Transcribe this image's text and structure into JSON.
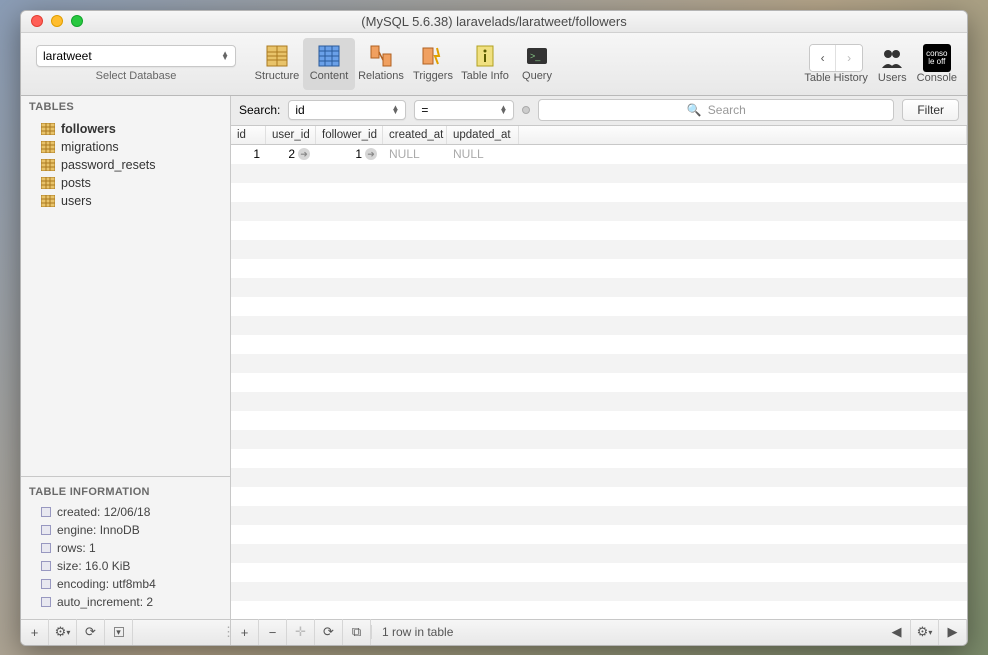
{
  "window": {
    "title": "(MySQL 5.6.38) laravelads/laratweet/followers"
  },
  "dbselect": {
    "value": "laratweet",
    "label": "Select Database"
  },
  "toolbar": {
    "buttons": {
      "structure": "Structure",
      "content": "Content",
      "relations": "Relations",
      "triggers": "Triggers",
      "tableinfo": "Table Info",
      "query": "Query"
    },
    "right": {
      "history": "Table History",
      "users": "Users",
      "console": "Console",
      "console_line1": "conso",
      "console_line2": "le off"
    }
  },
  "sidebar": {
    "tables_header": "TABLES",
    "tables": [
      "followers",
      "migrations",
      "password_resets",
      "posts",
      "users"
    ],
    "selected": "followers",
    "info_header": "TABLE INFORMATION",
    "info": [
      "created: 12/06/18",
      "engine: InnoDB",
      "rows: 1",
      "size: 16.0 KiB",
      "encoding: utf8mb4",
      "auto_increment: 2"
    ]
  },
  "search": {
    "label": "Search:",
    "field": "id",
    "op": "=",
    "placeholder": "Search",
    "filter": "Filter"
  },
  "columns": [
    "id",
    "user_id",
    "follower_id",
    "created_at",
    "updated_at"
  ],
  "rows": [
    {
      "id": "1",
      "user_id": "2",
      "follower_id": "1",
      "created_at": "NULL",
      "updated_at": "NULL"
    }
  ],
  "footer": {
    "status": "1 row in table"
  }
}
